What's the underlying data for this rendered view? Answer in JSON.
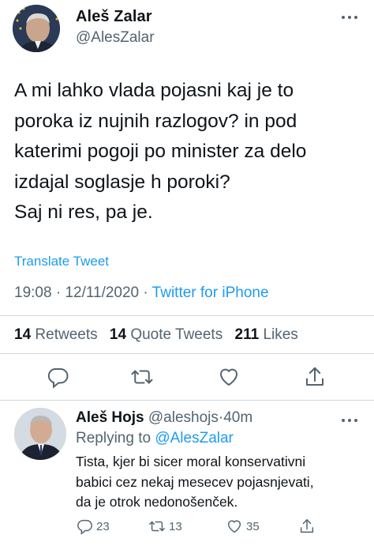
{
  "tweet": {
    "author_name": "Aleš Zalar",
    "author_handle": "@AlesZalar",
    "text": "A mi lahko vlada pojasni kaj je to\nporoka iz nujnih razlogov? in pod\nkaterimi pogoji po minister za delo\nizdajal soglasje h poroki?\nSaj ni res, pa je.",
    "translate_label": "Translate Tweet",
    "time": "19:08",
    "date": "12/11/2020",
    "separator": "·",
    "source": "Twitter for iPhone",
    "stats": {
      "retweets_count": "14",
      "retweets_label": "Retweets",
      "quote_count": "14",
      "quote_label": "Quote Tweets",
      "likes_count": "211",
      "likes_label": "Likes"
    },
    "icons": [
      "reply-icon",
      "retweet-icon",
      "like-icon",
      "share-icon",
      "more-icon"
    ]
  },
  "reply": {
    "author_name": "Aleš Hojs",
    "author_handle": "@aleshojs",
    "separator": "·",
    "time_ago": "40m",
    "replying_prefix": "Replying to",
    "replying_to": "@AlesZalar",
    "text": "Tista, kjer bi sicer moral konservativni\nbabici cez nekaj mesecev pojasnjevati,\nda je otrok nedonošenček.",
    "reply_count": "23",
    "retweet_count": "13",
    "like_count": "35"
  },
  "colors": {
    "text": "#0f1419",
    "secondary": "#536471",
    "link": "#1d9bf0",
    "divider": "#cfd9de"
  }
}
